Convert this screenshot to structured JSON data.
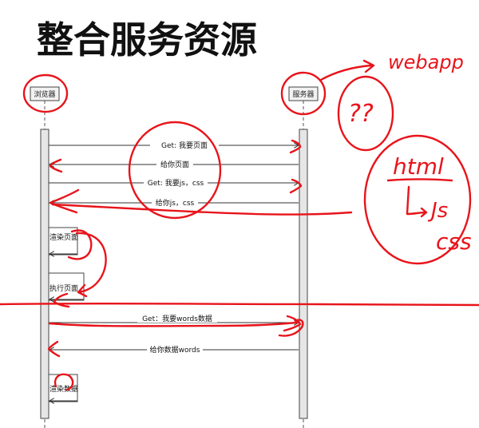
{
  "title": "整合服务资源",
  "participants": {
    "browser": "浏览器",
    "server": "服务器"
  },
  "messages": [
    "Get: 我要页面",
    "给你页面",
    "Get: 我要js，css",
    "给你js，css",
    "Get：我要words数据",
    "给你数据words"
  ],
  "self_steps": [
    "渲染页面",
    "执行页面",
    "渲染数据"
  ],
  "annotations": {
    "webapp": "webapp",
    "question": "??",
    "html": "html",
    "js": "Js",
    "css": "css"
  }
}
